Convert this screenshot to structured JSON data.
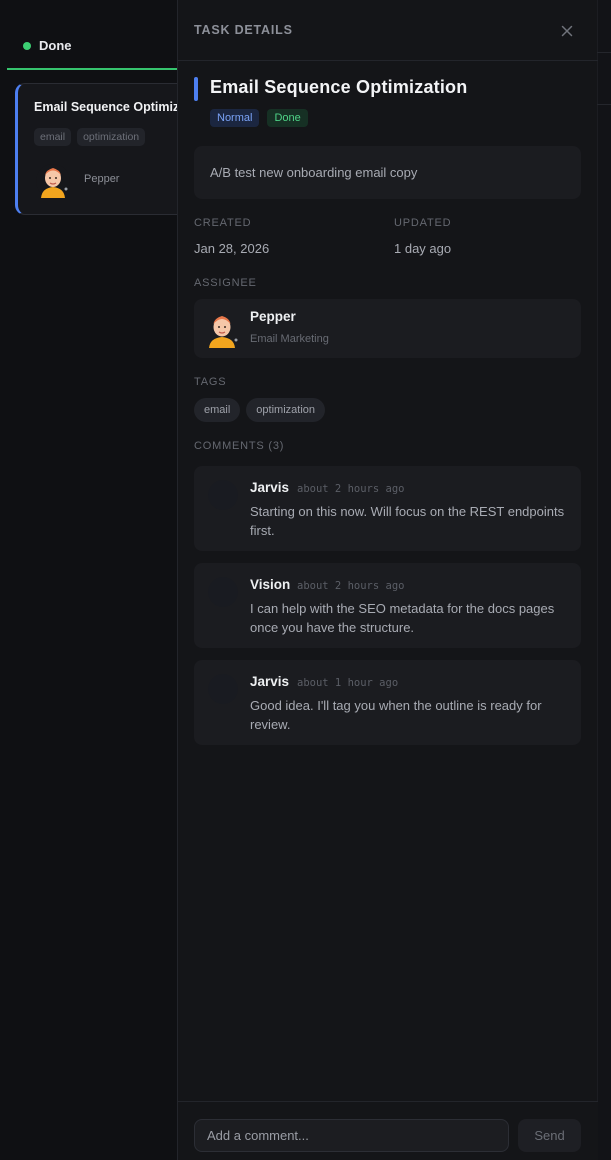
{
  "column": {
    "title": "Done",
    "status_color": "#3ccf73"
  },
  "card": {
    "title": "Email Sequence Optimization",
    "tags": [
      "email",
      "optimization"
    ],
    "assignee": "Pepper",
    "accent_color": "#4d7ff0"
  },
  "panel": {
    "header_title": "TASK DETAILS",
    "close_icon": "close-icon",
    "task": {
      "title": "Email Sequence Optimization",
      "priority": "Normal",
      "status": "Done",
      "description": "A/B test new onboarding email copy"
    },
    "meta": {
      "created_label": "CREATED",
      "created_value": "Jan 28, 2026",
      "updated_label": "UPDATED",
      "updated_value": "1 day ago"
    },
    "assignee": {
      "label": "ASSIGNEE",
      "name": "Pepper",
      "role": "Email Marketing"
    },
    "tags": {
      "label": "TAGS",
      "items": [
        "email",
        "optimization"
      ]
    },
    "comments": {
      "label": "COMMENTS (3)",
      "items": [
        {
          "author": "Jarvis",
          "time": "about 2 hours ago",
          "text": "Starting on this now. Will focus on the REST endpoints first."
        },
        {
          "author": "Vision",
          "time": "about 2 hours ago",
          "text": "I can help with the SEO metadata for the docs pages once you have the structure."
        },
        {
          "author": "Jarvis",
          "time": "about 1 hour ago",
          "text": "Good idea. I'll tag you when the outline is ready for review."
        }
      ]
    },
    "footer": {
      "input_placeholder": "Add a comment...",
      "input_value": "",
      "send_label": "Send"
    }
  }
}
